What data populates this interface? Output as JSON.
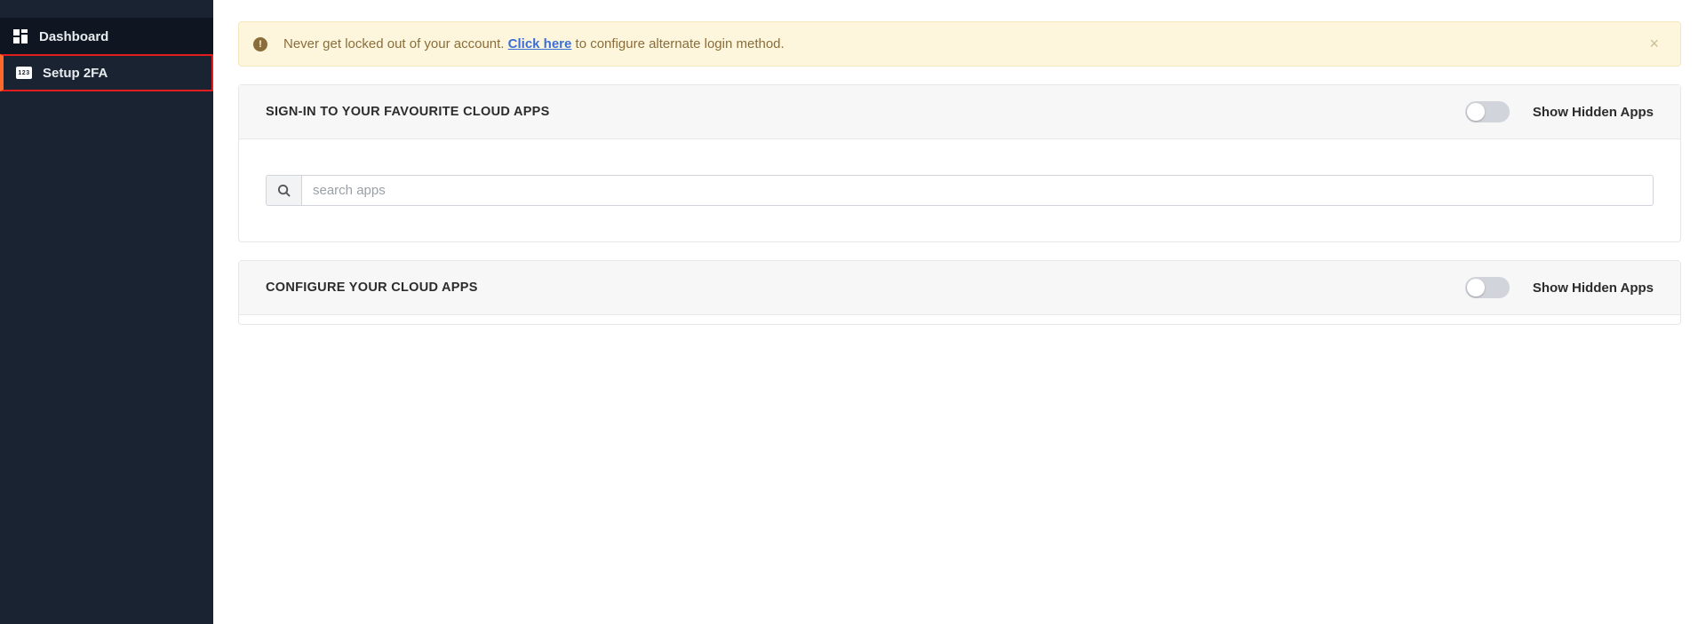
{
  "sidebar": {
    "items": [
      {
        "label": "Dashboard"
      },
      {
        "label": "Setup 2FA"
      }
    ],
    "icon123_text": "123"
  },
  "alert": {
    "text_before": "Never get locked out of your account. ",
    "link_text": "Click here",
    "text_after": " to configure alternate login method.",
    "close_glyph": "×",
    "icon_glyph": "!"
  },
  "panel_signin": {
    "title": "SIGN-IN TO YOUR FAVOURITE CLOUD APPS",
    "toggle_label": "Show Hidden Apps",
    "search_placeholder": "search apps"
  },
  "panel_configure": {
    "title": "CONFIGURE YOUR CLOUD APPS",
    "toggle_label": "Show Hidden Apps"
  }
}
